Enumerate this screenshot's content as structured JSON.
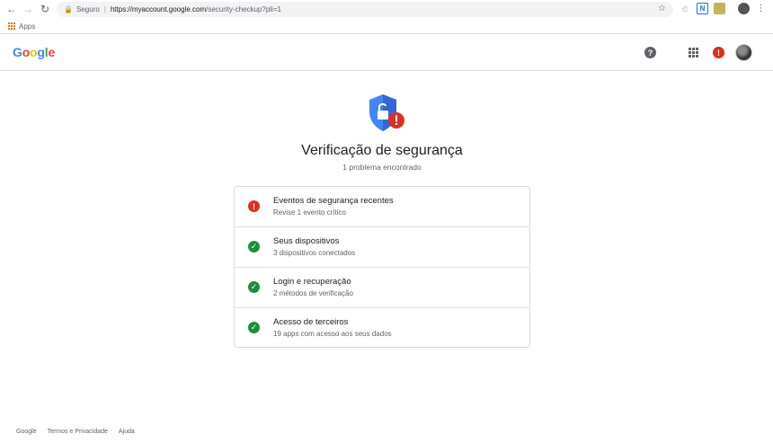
{
  "browser": {
    "secure_label": "Seguro",
    "url_host": "https://myaccount.google.com",
    "url_path": "/security-checkup?pli=1",
    "bookmark_apps": "Apps"
  },
  "header": {
    "logo": "Google"
  },
  "main": {
    "title": "Verificação de segurança",
    "subtitle": "1 problema encontrado",
    "items": [
      {
        "title": "Eventos de segurança recentes",
        "desc": "Revise 1 evento crítico",
        "status": "alert"
      },
      {
        "title": "Seus dispositivos",
        "desc": "3 dispositivos conectados",
        "status": "ok"
      },
      {
        "title": "Login e recuperação",
        "desc": "2 métodos de verificação",
        "status": "ok"
      },
      {
        "title": "Acesso de terceiros",
        "desc": "19 apps com acesso aos seus dados",
        "status": "ok"
      }
    ]
  },
  "footer": {
    "links": [
      "Google",
      "Termos e Privacidade",
      "Ajuda"
    ]
  },
  "colors": {
    "alert": "#d93025",
    "ok": "#1e8e3e",
    "shield_blue": "#4285f4"
  }
}
